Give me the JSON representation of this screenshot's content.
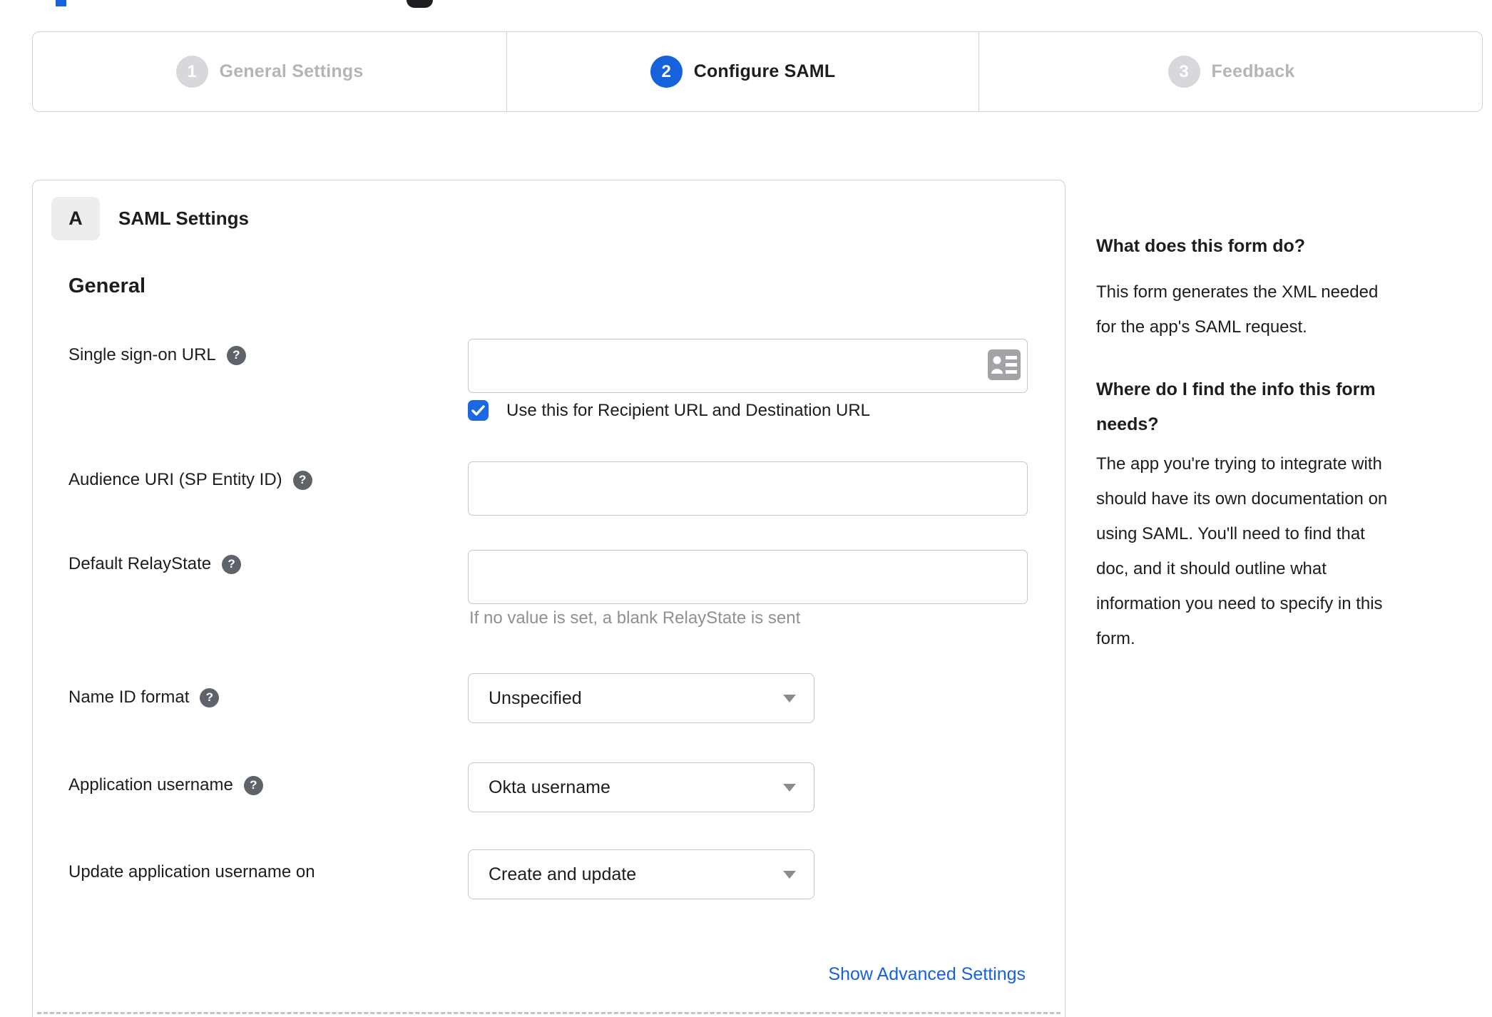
{
  "colors": {
    "accent_blue": "#1662dd",
    "text_dark": "#1d1d21",
    "inactive_gray": "#b4b4b9",
    "help_icon_bg": "#5e6369",
    "border_gray": "#d2d2d7",
    "hint_gray": "#8f8f94"
  },
  "stepper": {
    "steps": [
      {
        "number": "1",
        "label": "General Settings",
        "state": "inactive"
      },
      {
        "number": "2",
        "label": "Configure SAML",
        "state": "active"
      },
      {
        "number": "3",
        "label": "Feedback",
        "state": "inactive"
      }
    ]
  },
  "panel": {
    "badge": "A",
    "title": "SAML Settings",
    "general_heading": "General",
    "advanced_link": "Show Advanced Settings"
  },
  "form": {
    "sso": {
      "label": "Single sign-on URL",
      "value": "",
      "has_help": true,
      "checkbox_label": "Use this for Recipient URL and Destination URL",
      "checkbox_checked": true
    },
    "audience": {
      "label": "Audience URI (SP Entity ID)",
      "value": "",
      "has_help": true
    },
    "relay": {
      "label": "Default RelayState",
      "value": "",
      "has_help": true,
      "hint": "If no value is set, a blank RelayState is sent"
    },
    "name_id_format": {
      "label": "Name ID format",
      "value": "Unspecified",
      "has_help": true
    },
    "app_username": {
      "label": "Application username",
      "value": "Okta username",
      "has_help": true
    },
    "update_username": {
      "label": "Update application username on",
      "value": "Create and update",
      "has_help": false
    },
    "help_glyph": "?"
  },
  "sidebar": {
    "q1": "What does this form do?",
    "q1_lines": [
      "What does this form do?"
    ],
    "a1": "This form generates the XML needed for the app's SAML request.",
    "a1_lines": [
      "This form generates the XML needed",
      "for the app's SAML request."
    ],
    "q2": "Where do I find the info this form needs?",
    "q2_lines": [
      "Where do I find the info this form",
      "needs?"
    ],
    "a2": "The app you're trying to integrate with should have its own documentation on using SAML. You'll need to find that doc, and it should outline what information you need to specify in this form.",
    "a2_lines": [
      "The app you're trying to integrate with",
      "should have its own documentation on",
      "using SAML. You'll need to find that",
      "doc, and it should outline what",
      "information you need to specify in this",
      "form."
    ]
  }
}
